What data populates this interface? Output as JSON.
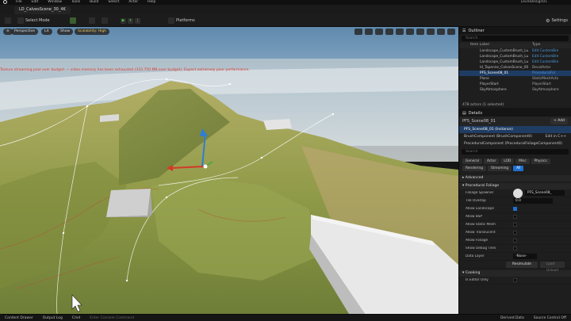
{
  "menubar": {
    "items": [
      "File",
      "Edit",
      "Window",
      "Tools",
      "Build",
      "Select",
      "Actor",
      "Help"
    ],
    "project": "LevelDesign01"
  },
  "tab": {
    "label": "LD_CalvesScene_30_4K"
  },
  "toolbar": {
    "select_mode": "Select Mode",
    "platforms": "Platforms",
    "settings": "Settings"
  },
  "viewport": {
    "pills": [
      "Perspective",
      "Lit",
      "Show",
      "Scalability: High"
    ],
    "warning": "Texture streaming pool over budget: ~ video memory has been exhausted (333.750 MB over budget). Expect extremely poor performance."
  },
  "outliner": {
    "title": "Outliner",
    "search_placeholder": "Search",
    "col_label": "Item Label",
    "col_type": "Type",
    "rows": [
      {
        "label": "Landscape_CustomBrush_Lu",
        "type": "Edit CustomBre",
        "sel": false
      },
      {
        "label": "Landscape_CustomBrush_Lu",
        "type": "Edit CustomBre",
        "sel": false
      },
      {
        "label": "Landscape_CustomBrush_Lu",
        "type": "Edit CustomBre",
        "sel": false
      },
      {
        "label": "ld_Tapenne_CalvesScene_00",
        "type": "DecalActor",
        "sel": false
      },
      {
        "label": "PFS_Scene08_01",
        "type": "ProceduralFol",
        "sel": true
      },
      {
        "label": "Plane",
        "type": "StaticMeshActo",
        "sel": false
      },
      {
        "label": "PlayerStart",
        "type": "PlayerStart",
        "sel": false
      },
      {
        "label": "SkyAtmosphere",
        "type": "SkyAtmosphere",
        "sel": false
      }
    ],
    "count": "478 actors (1 selected)"
  },
  "details": {
    "title": "Details",
    "actor": "PFS_Scene08_01",
    "add_label": "+ Add",
    "components": [
      {
        "label": "PFS_Scene08_01 (Instance)",
        "right": "",
        "hl": true
      },
      {
        "label": "BrushComponent (BrushComponent0)",
        "right": "Edit in C++",
        "hl": false
      },
      {
        "label": "ProceduralComponent (ProceduralFoliageComponent0)",
        "right": "",
        "hl": false
      }
    ],
    "search_placeholder": "Search",
    "tabs": [
      "General",
      "Actor",
      "LOD",
      "Misc",
      "Physics",
      "Rendering",
      "Streaming",
      "All"
    ],
    "sec_advanced": "Advanced",
    "sec_foliage": "Procedural Foliage",
    "props": [
      {
        "label": "Foliage Spawner",
        "value": "PFS_Scene08_",
        "kind": "asset"
      },
      {
        "label": "Tile Overlap",
        "value": "0.0",
        "kind": "input"
      },
      {
        "label": "Allow Landscape",
        "value": "",
        "kind": "check-on"
      },
      {
        "label": "Allow BSP",
        "value": "",
        "kind": "check"
      },
      {
        "label": "Allow Static Mesh",
        "value": "",
        "kind": "check"
      },
      {
        "label": "Allow Translucent",
        "value": "",
        "kind": "check"
      },
      {
        "label": "Allow Foliage",
        "value": "",
        "kind": "check"
      },
      {
        "label": "Show Debug Tiles",
        "value": "",
        "kind": "check"
      },
      {
        "label": "Data Layer",
        "value": "-None-",
        "kind": "select"
      }
    ],
    "resimulate": "Resimulate",
    "load_unload": "Load Unload",
    "sec_cooking": "Cooking",
    "editor_only": "Is Editor Only"
  },
  "statusbar": {
    "content_drawer": "Content Drawer",
    "output_log": "Output Log",
    "cmd": "Cmd",
    "cmd_placeholder": "Enter Console Command",
    "derived_data": "Derived Data",
    "source_control": "Source Control Off"
  }
}
